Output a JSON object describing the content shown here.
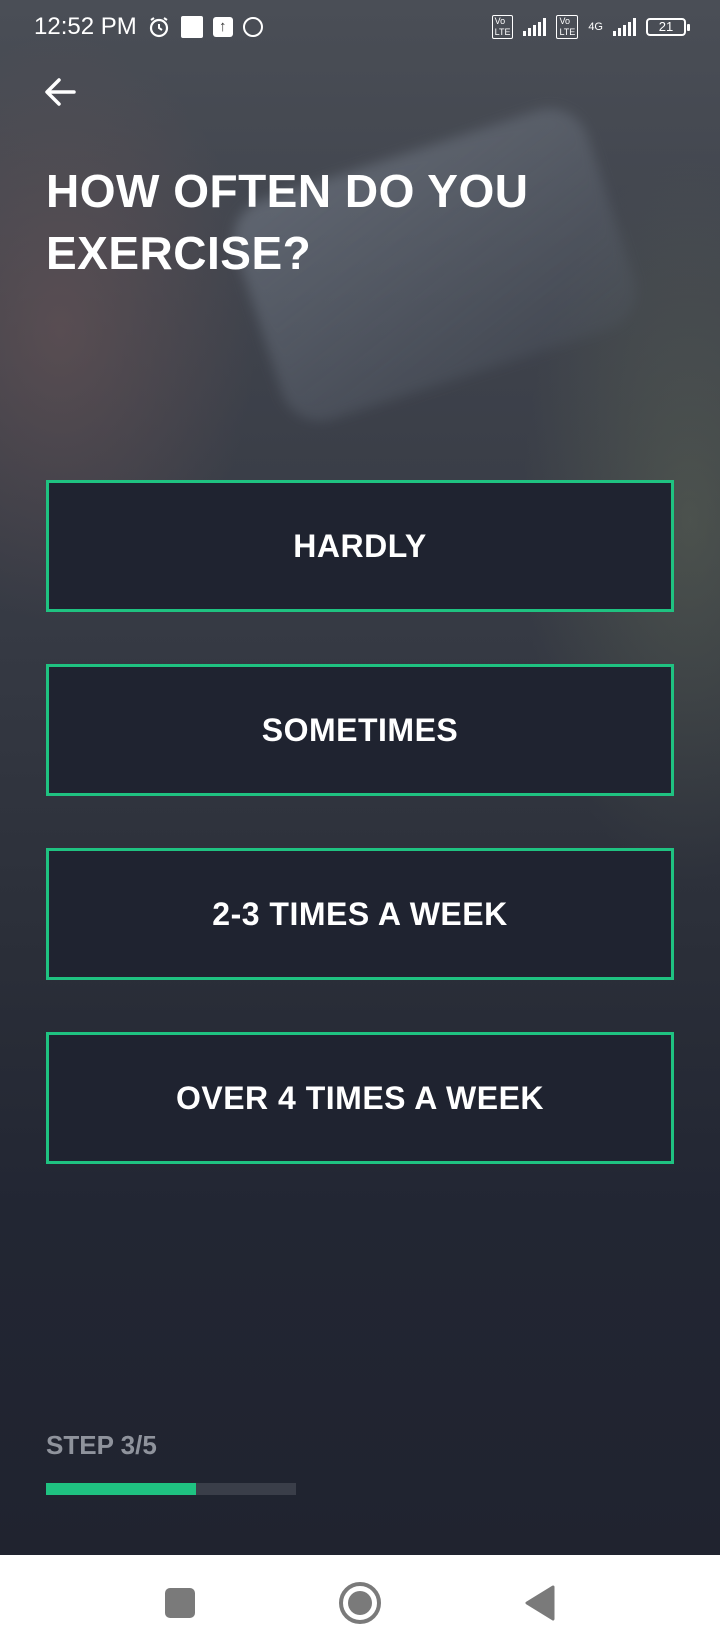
{
  "status_bar": {
    "time": "12:52 PM",
    "network": "4G",
    "battery": "21",
    "icons": [
      "alarm-icon",
      "square-notification-icon",
      "upload-icon",
      "vpn-icon",
      "volte-icon",
      "signal-icon",
      "volte-icon",
      "signal-4g-icon",
      "battery-icon"
    ]
  },
  "header": {
    "back_icon": "arrow-left-icon",
    "title": "HOW OFTEN DO YOU EXERCISE?"
  },
  "options": [
    {
      "label": "HARDLY"
    },
    {
      "label": "SOMETIMES"
    },
    {
      "label": "2-3 TIMES A WEEK"
    },
    {
      "label": "OVER 4 TIMES A WEEK"
    }
  ],
  "progress": {
    "step_label": "STEP 3/5",
    "current": 3,
    "total": 5,
    "fraction": 0.6
  },
  "nav": {
    "icons": [
      "recent-apps-icon",
      "home-icon",
      "back-triangle-icon"
    ]
  },
  "colors": {
    "accent": "#1fc281",
    "card_bg": "#1f2330",
    "nav_bg": "#ffffff",
    "step_label": "#8f939c"
  }
}
